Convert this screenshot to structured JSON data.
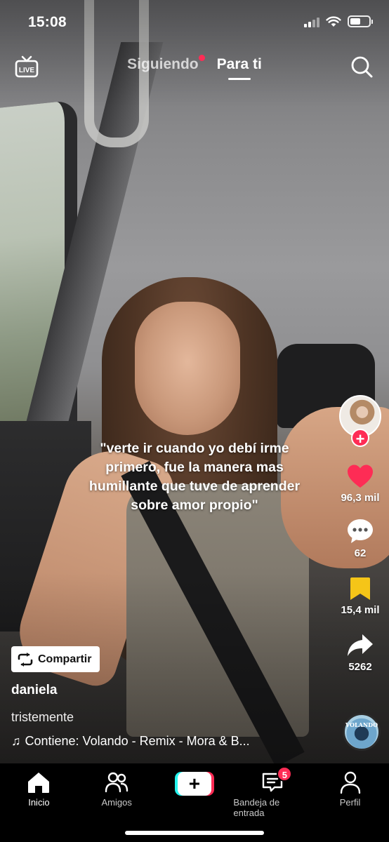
{
  "status_bar": {
    "time": "15:08"
  },
  "top_nav": {
    "live_label": "LIVE",
    "tabs": [
      {
        "label": "Siguiendo",
        "active": false,
        "has_dot": true
      },
      {
        "label": "Para ti",
        "active": true,
        "has_dot": false
      }
    ]
  },
  "video": {
    "caption": "\"verte ir cuando yo debí irme primero, fue la manera mas humillante que tuve de aprender sobre amor propio\"",
    "share_label": "Compartir",
    "username": "daniela",
    "description": "tristemente",
    "music": "Contiene: Volando - Remix - Mora & B...",
    "disc_label": "VOLANDO"
  },
  "actions": {
    "likes": "96,3 mil",
    "comments": "62",
    "saves": "15,4 mil",
    "shares": "5262"
  },
  "bottom_nav": {
    "items": [
      {
        "label": "Inicio",
        "icon": "home-icon",
        "active": true
      },
      {
        "label": "Amigos",
        "icon": "friends-icon",
        "active": false
      },
      {
        "label": "",
        "icon": "create-icon",
        "active": false
      },
      {
        "label": "Bandeja de entrada",
        "icon": "inbox-icon",
        "active": false,
        "badge": "5"
      },
      {
        "label": "Perfil",
        "icon": "profile-icon",
        "active": false
      }
    ]
  },
  "colors": {
    "accent": "#fe2c55",
    "cyan": "#25f4ee",
    "save": "#f5c518"
  }
}
